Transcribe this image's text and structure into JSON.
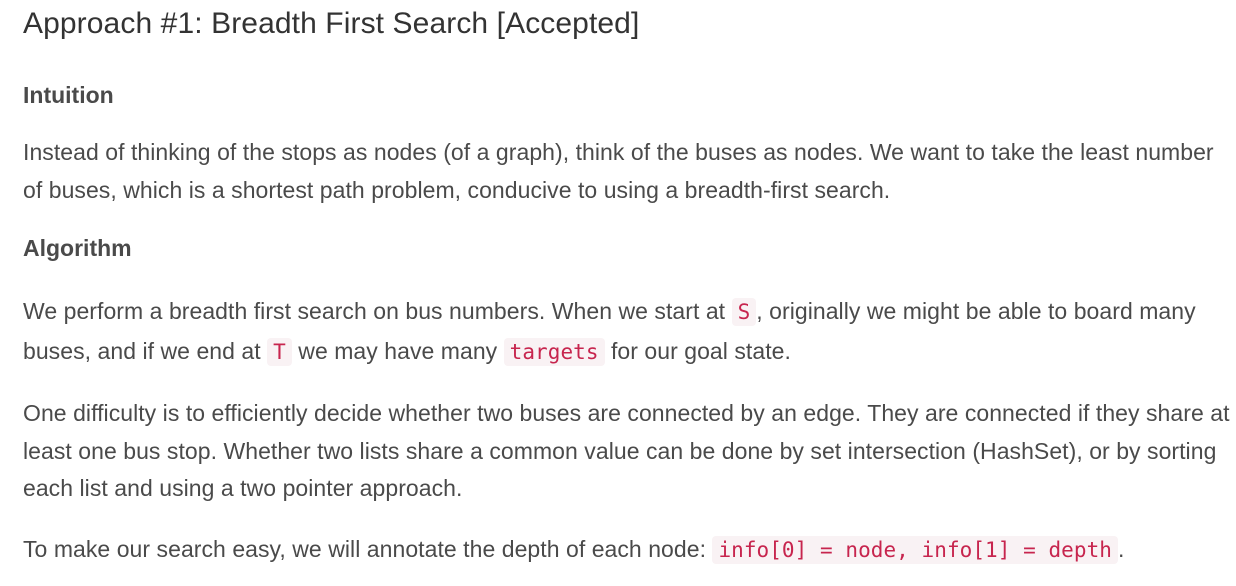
{
  "article": {
    "title": "Approach #1: Breadth First Search [Accepted]",
    "intuition": {
      "heading": "Intuition",
      "text": "Instead of thinking of the stops as nodes (of a graph), think of the buses as nodes. We want to take the least number of buses, which is a shortest path problem, conducive to using a breadth-first search."
    },
    "algorithm": {
      "heading": "Algorithm",
      "p1": {
        "t1": "We perform a breadth first search on bus numbers. When we start at ",
        "code1": "S",
        "t2": ", originally we might be able to board many buses, and if we end at ",
        "code2": "T",
        "t3": " we may have many ",
        "code3": "targets",
        "t4": " for our goal state."
      },
      "p2": "One difficulty is to efficiently decide whether two buses are connected by an edge. They are connected if they share at least one bus stop. Whether two lists share a common value can be done by set intersection (HashSet), or by sorting each list and using a two pointer approach.",
      "p3": {
        "t1": "To make our search easy, we will annotate the depth of each node: ",
        "code1": "info[0] = node, info[1] = depth",
        "t2": "."
      }
    }
  }
}
